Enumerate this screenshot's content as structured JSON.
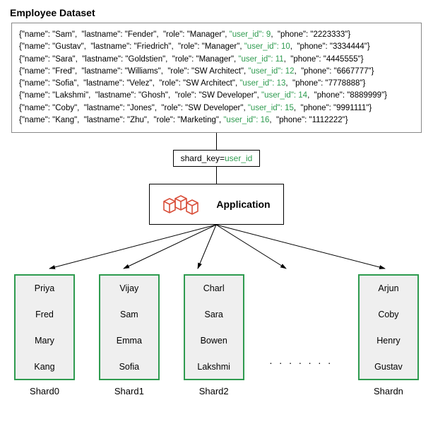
{
  "title": "Employee Dataset",
  "records": [
    {
      "name": "Sam",
      "lastname": "Fender",
      "role": "Manager",
      "user_id": 9,
      "phone": "2223333"
    },
    {
      "name": "Gustav",
      "lastname": "Friedrich",
      "role": "Manager",
      "user_id": 10,
      "phone": "3334444"
    },
    {
      "name": "Sara",
      "lastname": "Goldstien",
      "role": "Manager",
      "user_id": 11,
      "phone": "4445555"
    },
    {
      "name": "Fred",
      "lastname": "Williams",
      "role": "SW Architect",
      "user_id": 12,
      "phone": "6667777"
    },
    {
      "name": "Sofia",
      "lastname": "Velez",
      "role": "SW Architect",
      "user_id": 13,
      "phone": "7778888"
    },
    {
      "name": "Lakshmi",
      "lastname": "Ghosh",
      "role": "SW Developer",
      "user_id": 14,
      "phone": "8889999"
    },
    {
      "name": "Coby",
      "lastname": "Jones",
      "role": "SW Developer",
      "user_id": 15,
      "phone": "9991111"
    },
    {
      "name": "Kang",
      "lastname": "Zhu",
      "role": "Marketing",
      "user_id": 16,
      "phone": "1112222"
    }
  ],
  "shard_key_label": "shard_key=",
  "shard_key_value": "user_id",
  "application_label": "Application",
  "ellipsis": ". . . . . . .",
  "shards": [
    {
      "label": "Shard0",
      "items": [
        "Priya",
        "Fred",
        "Mary",
        "Kang"
      ]
    },
    {
      "label": "Shard1",
      "items": [
        "Vijay",
        "Sam",
        "Emma",
        "Sofia"
      ]
    },
    {
      "label": "Shard2",
      "items": [
        "Charl",
        "Sara",
        "Bowen",
        "Lakshmi"
      ]
    },
    {
      "label": "Shardn",
      "items": [
        "Arjun",
        "Coby",
        "Henry",
        "Gustav"
      ]
    }
  ]
}
